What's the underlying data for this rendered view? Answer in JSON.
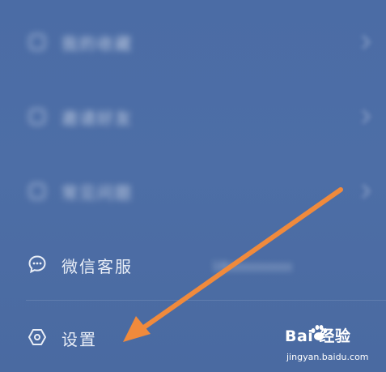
{
  "menu": {
    "items": [
      {
        "label": "我的收藏",
        "icon": "cube-icon"
      },
      {
        "label": "邀请好友",
        "icon": "cube-icon"
      },
      {
        "label": "常见问题",
        "icon": "cube-icon"
      },
      {
        "label": "微信客服",
        "icon": "chat-bubble-icon"
      },
      {
        "label": "设置",
        "icon": "settings-icon"
      }
    ],
    "wechat_value": "18xxxxxxxxx"
  },
  "watermark": {
    "title": "Bai 经验",
    "url": "jingyan.baidu.com"
  },
  "colors": {
    "background": "#4a6ba3",
    "arrow": "#f08a3c",
    "text": "#e9eef7"
  }
}
